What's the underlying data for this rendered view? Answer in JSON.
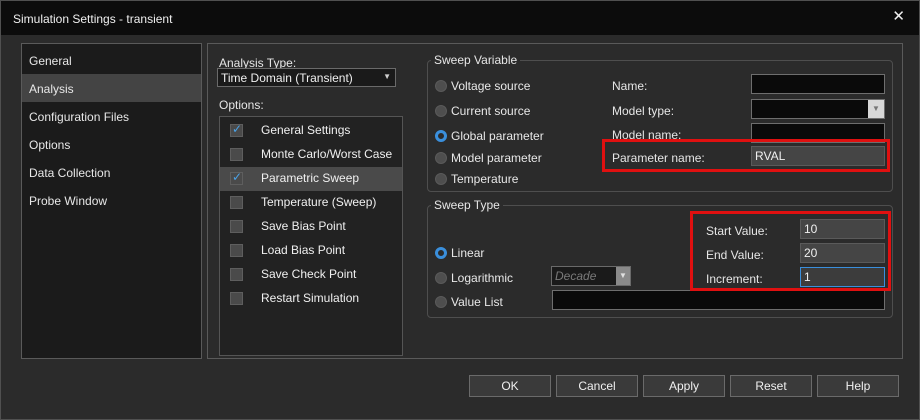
{
  "window": {
    "title": "Simulation Settings - transient",
    "close_glyph": "✕"
  },
  "nav": {
    "items": [
      {
        "label": "General",
        "active": false
      },
      {
        "label": "Analysis",
        "active": true
      },
      {
        "label": "Configuration Files",
        "active": false
      },
      {
        "label": "Options",
        "active": false
      },
      {
        "label": "Data Collection",
        "active": false
      },
      {
        "label": "Probe Window",
        "active": false
      }
    ]
  },
  "analysis": {
    "type_label": "Analysis Type:",
    "type_value": "Time Domain (Transient)",
    "options_label": "Options:",
    "options": [
      {
        "label": "General Settings",
        "checked": true,
        "selected": false
      },
      {
        "label": "Monte Carlo/Worst Case",
        "checked": false,
        "selected": false
      },
      {
        "label": "Parametric Sweep",
        "checked": true,
        "selected": true
      },
      {
        "label": "Temperature (Sweep)",
        "checked": false,
        "selected": false
      },
      {
        "label": "Save Bias Point",
        "checked": false,
        "selected": false
      },
      {
        "label": "Load Bias Point",
        "checked": false,
        "selected": false
      },
      {
        "label": "Save Check Point",
        "checked": false,
        "selected": false
      },
      {
        "label": "Restart Simulation",
        "checked": false,
        "selected": false
      }
    ]
  },
  "sweep_variable": {
    "title": "Sweep Variable",
    "radios": [
      {
        "label": "Voltage source",
        "selected": false
      },
      {
        "label": "Current source",
        "selected": false
      },
      {
        "label": "Global parameter",
        "selected": true
      },
      {
        "label": "Model parameter",
        "selected": false
      },
      {
        "label": "Temperature",
        "selected": false
      }
    ],
    "name_label": "Name:",
    "name_value": "",
    "model_type_label": "Model type:",
    "model_type_value": "",
    "model_name_label": "Model name:",
    "model_name_value": "",
    "param_name_label": "Parameter name:",
    "param_name_value": "RVAL"
  },
  "sweep_type": {
    "title": "Sweep Type",
    "radios": [
      {
        "label": "Linear",
        "selected": true
      },
      {
        "label": "Logarithmic",
        "selected": false
      },
      {
        "label": "Value List",
        "selected": false
      }
    ],
    "log_combo_value": "Decade",
    "value_list_value": "",
    "start_label": "Start Value:",
    "start_value": "10",
    "end_label": "End Value:",
    "end_value": "20",
    "increment_label": "Increment:",
    "increment_value": "1"
  },
  "buttons": {
    "ok": "OK",
    "cancel": "Cancel",
    "apply": "Apply",
    "reset": "Reset",
    "help": "Help"
  },
  "colors": {
    "accent": "#3a8fdc",
    "highlight": "#e01010",
    "background": "#2b2b2b"
  }
}
